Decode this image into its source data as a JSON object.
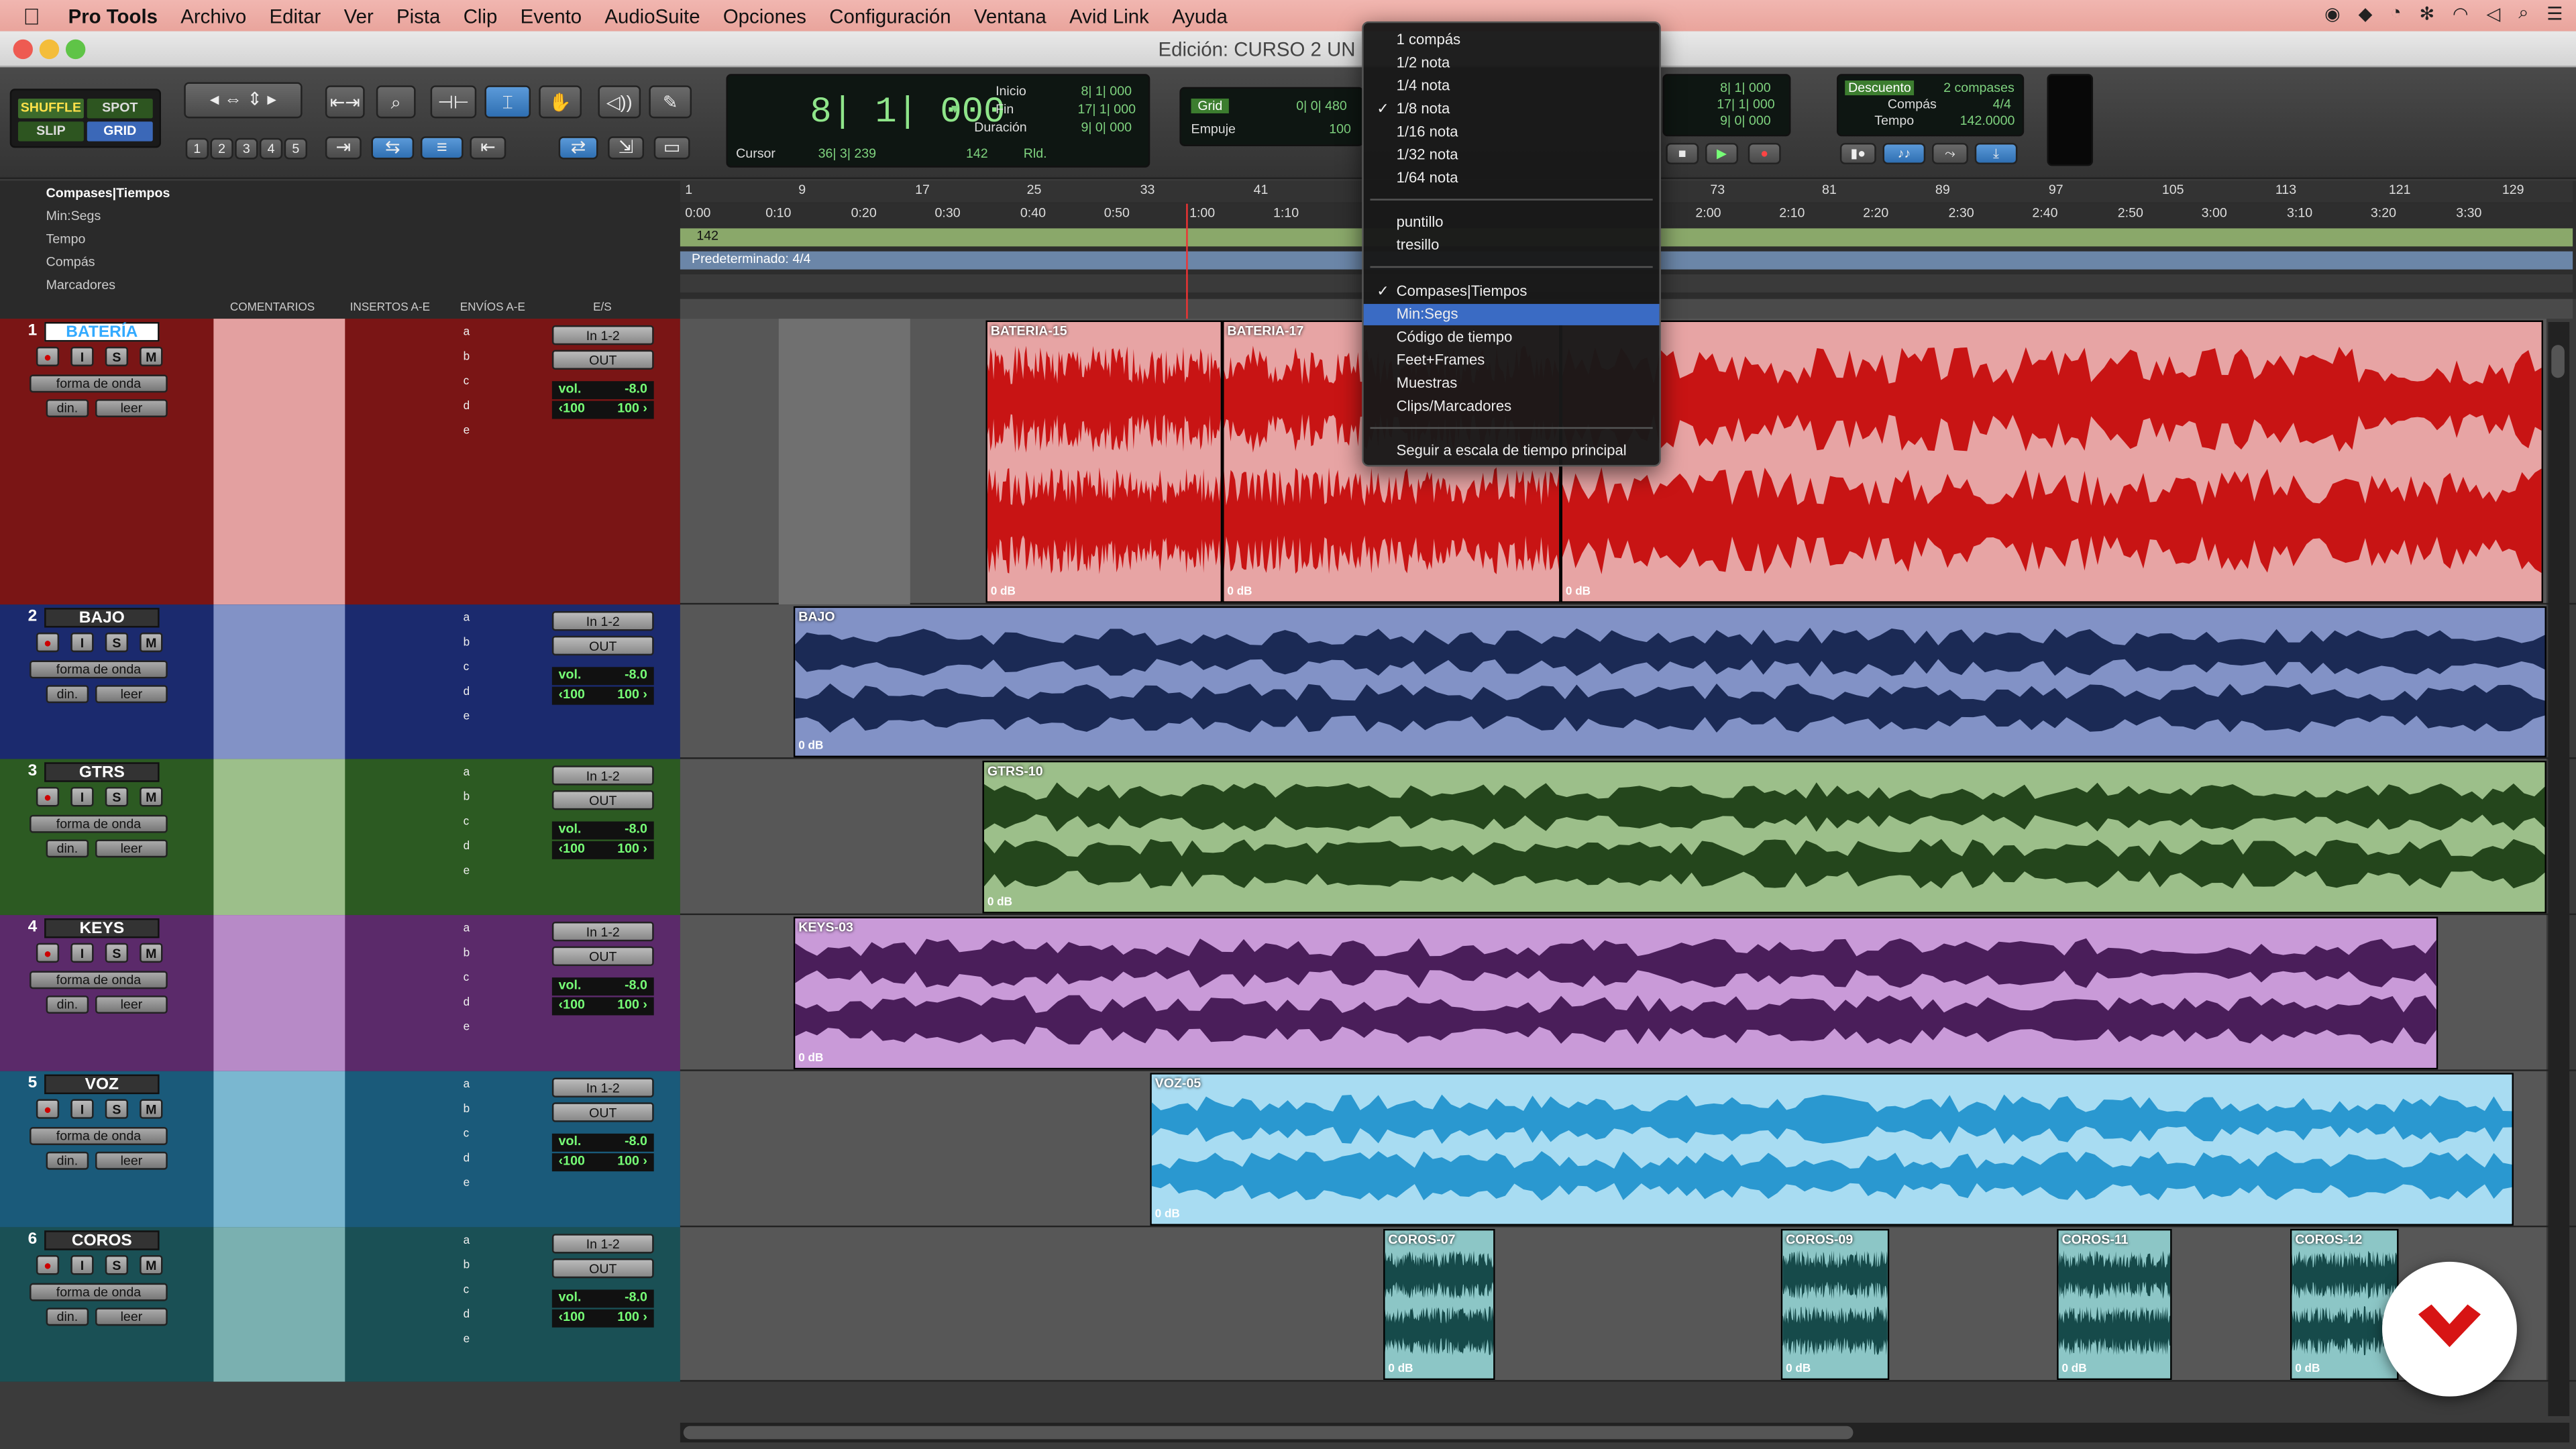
{
  "menubar": {
    "app": "Pro Tools",
    "items": [
      "Archivo",
      "Editar",
      "Ver",
      "Pista",
      "Clip",
      "Evento",
      "AudioSuite",
      "Opciones",
      "Configuración",
      "Ventana",
      "Avid Link",
      "Ayuda"
    ]
  },
  "window": {
    "title": "Edición: CURSO 2 UN"
  },
  "toolbar": {
    "modes": {
      "shuffle": "SHUFFLE",
      "spot": "SPOT",
      "slip": "SLIP",
      "grid": "GRID"
    },
    "zoom_presets": [
      "1",
      "2",
      "3",
      "4",
      "5"
    ],
    "counter": {
      "main": "8| 1| 000",
      "inicio_label": "Inicio",
      "fin_label": "Fin",
      "duracion_label": "Duración",
      "inicio": "8| 1| 000",
      "fin": "17| 1| 000",
      "duracion": "9| 0| 000",
      "cursor_label": "Cursor",
      "cursor": "36| 3| 239",
      "tempo_small": "142",
      "rld": "Rld."
    },
    "grid": {
      "label": "Grid",
      "value": "0| 0| 480",
      "empuje_label": "Empuje",
      "empuje": "100"
    },
    "sel2": {
      "a": "8| 1| 000",
      "b": "17| 1| 000",
      "c": "9| 0| 000"
    },
    "countoff": {
      "label": "Descuento",
      "value": "2 compases",
      "compas_label": "Compás",
      "compas": "4/4",
      "tempo_label": "Tempo",
      "tempo": "142.0000"
    }
  },
  "rulers": {
    "labels": [
      "Compases|Tiempos",
      "Min:Segs",
      "Tempo",
      "Compás",
      "Marcadores"
    ],
    "bars": [
      "1",
      "9",
      "17",
      "25",
      "33",
      "41",
      "73",
      "81",
      "89",
      "97",
      "105",
      "113",
      "121",
      "129"
    ],
    "mins": [
      "0:00",
      "0:10",
      "0:20",
      "0:30",
      "0:40",
      "0:50",
      "1:00",
      "1:10",
      "2:00",
      "2:10",
      "2:20",
      "2:30",
      "2:40",
      "2:50",
      "3:00",
      "3:10",
      "3:20",
      "3:30"
    ],
    "tempo_value": "142",
    "meter_value": "Predeterminado: 4/4"
  },
  "columns": {
    "comments": "COMENTARIOS",
    "inserts": "INSERTOS A-E",
    "sends": "ENVÍOS A-E",
    "io": "E/S"
  },
  "common": {
    "input": "In 1-2",
    "output": "OUT",
    "vol_label": "vol.",
    "vol": "-8.0",
    "pan_l": "‹100",
    "pan_r": "100 ›",
    "view": "forma de onda",
    "dyn": "din.",
    "read": "leer",
    "rec": "●",
    "inp": "I",
    "solo": "S",
    "mute": "M",
    "sends": [
      "a",
      "b",
      "c",
      "d",
      "e"
    ]
  },
  "tracks": [
    {
      "num": "1",
      "name": "BATERÍA",
      "color": "#7a1515",
      "light": "#e3a0a0"
    },
    {
      "num": "2",
      "name": "BAJO",
      "color": "#1b2a6e",
      "light": "#8292c6"
    },
    {
      "num": "3",
      "name": "GTRS",
      "color": "#2c5a22",
      "light": "#9cbf8a"
    },
    {
      "num": "4",
      "name": "KEYS",
      "color": "#5b2a6a",
      "light": "#b78ac7"
    },
    {
      "num": "5",
      "name": "VOZ",
      "color": "#1a5a7a",
      "light": "#7ab7d0"
    },
    {
      "num": "6",
      "name": "COROS",
      "color": "#1a5055",
      "light": "#7ab0b0"
    }
  ],
  "clips": {
    "bateria": [
      "BATERIA-15",
      "BATERIA-17"
    ],
    "bajo": "BAJO",
    "gtrs": "GTRS-10",
    "keys": "KEYS-03",
    "voz": "VOZ-05",
    "coros": [
      "COROS-07",
      "COROS-09",
      "COROS-11",
      "COROS-12"
    ],
    "gain": "0 dB"
  },
  "popup": {
    "grid_items": [
      "1 compás",
      "1/2 nota",
      "1/4 nota",
      "1/8 nota",
      "1/16 nota",
      "1/32 nota",
      "1/64 nota"
    ],
    "mod_items": [
      "puntillo",
      "tresillo"
    ],
    "scale_items": [
      "Compases|Tiempos",
      "Min:Segs",
      "Código de tiempo",
      "Feet+Frames",
      "Muestras",
      "Clips/Marcadores"
    ],
    "follow": "Seguir a escala de tiempo principal",
    "checked": "✓"
  }
}
